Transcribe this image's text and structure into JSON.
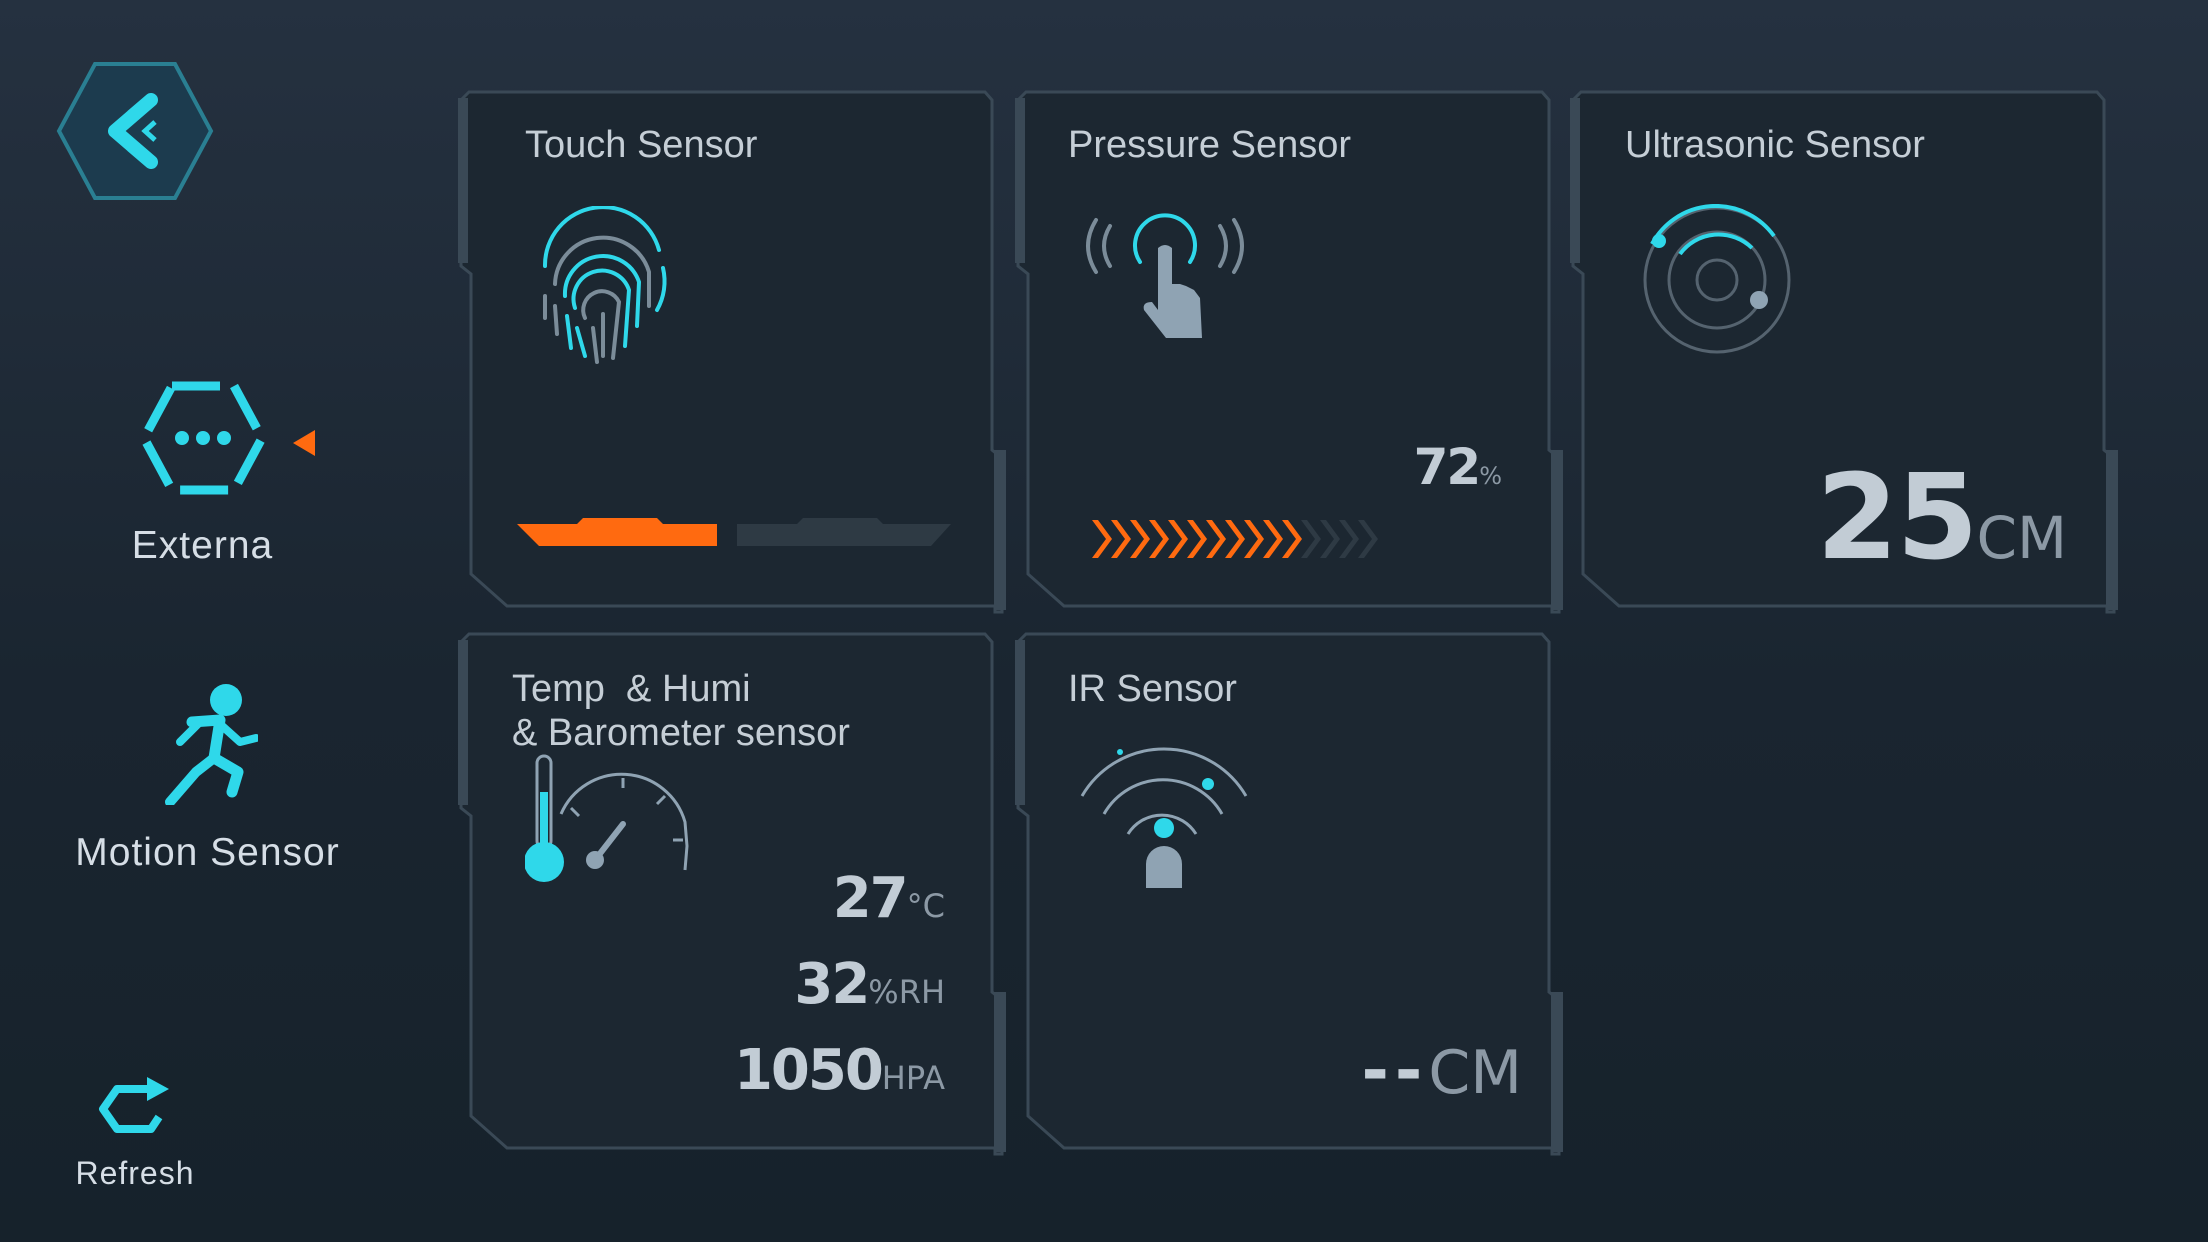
{
  "sidebar": {
    "back_icon": "back-arrow-hexagon-icon",
    "items": [
      {
        "label": "Externa",
        "icon": "hexagon-dots-icon",
        "selected": true
      },
      {
        "label": "Motion Sensor",
        "icon": "running-person-icon",
        "selected": false
      }
    ],
    "refresh": {
      "label": "Refresh",
      "icon": "refresh-icon"
    }
  },
  "colors": {
    "accent": "#2fd8ea",
    "active": "#ff6a10",
    "card_bg": "#1c2731"
  },
  "cards": {
    "touch": {
      "title": "Touch Sensor",
      "icon": "fingerprint-icon"
    },
    "pressure": {
      "title": "Pressure Sensor",
      "icon": "press-hand-icon",
      "value": "72",
      "unit": "%",
      "level": 0.72
    },
    "ultrasonic": {
      "title": "Ultrasonic Sensor",
      "icon": "radar-icon",
      "value": "25",
      "unit": "CM"
    },
    "temp": {
      "title_line1": "Temp  & Humi",
      "title_line2": "& Barometer sensor",
      "icon": "thermometer-gauge-icon",
      "temperature": {
        "value": "27",
        "unit": "°C"
      },
      "humidity": {
        "value": "32",
        "unit": "%RH"
      },
      "pressure": {
        "value": "1050",
        "unit": "HPA"
      }
    },
    "ir": {
      "title": "IR Sensor",
      "icon": "ir-signal-icon",
      "value": "--",
      "unit": "CM"
    }
  }
}
